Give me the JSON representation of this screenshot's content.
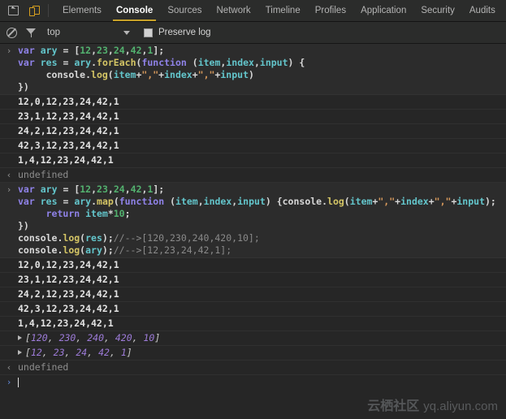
{
  "toolbar": {
    "inspect_icon": "inspect-element-icon",
    "device_icon": "device-toolbar-icon",
    "tabs": [
      {
        "label": "Elements",
        "active": false
      },
      {
        "label": "Console",
        "active": true
      },
      {
        "label": "Sources",
        "active": false
      },
      {
        "label": "Network",
        "active": false
      },
      {
        "label": "Timeline",
        "active": false
      },
      {
        "label": "Profiles",
        "active": false
      },
      {
        "label": "Application",
        "active": false
      },
      {
        "label": "Security",
        "active": false
      },
      {
        "label": "Audits",
        "active": false
      }
    ]
  },
  "filterbar": {
    "clear_icon": "clear-console-icon",
    "filter_icon": "filter-funnel-icon",
    "context": "top",
    "dropdown_icon": "chevron-down-icon",
    "preserve_log_label": "Preserve log",
    "preserve_log_checked": false
  },
  "console": {
    "input_marker": "›",
    "output_marker": "‹",
    "entries": [
      {
        "type": "command",
        "lines": [
          "var ary = [12,23,24,42,1];",
          "var res = ary.forEach(function (item,index,input) {",
          "     console.log(item+\",\"+index+\",\"+input)",
          "})"
        ]
      },
      {
        "type": "log",
        "text": "12,0,12,23,24,42,1"
      },
      {
        "type": "log",
        "text": "23,1,12,23,24,42,1"
      },
      {
        "type": "log",
        "text": "24,2,12,23,24,42,1"
      },
      {
        "type": "log",
        "text": "42,3,12,23,24,42,1"
      },
      {
        "type": "log",
        "text": "1,4,12,23,24,42,1"
      },
      {
        "type": "result",
        "text": "undefined"
      },
      {
        "type": "command",
        "lines": [
          "var ary = [12,23,24,42,1];",
          "var res = ary.map(function (item,index,input) {console.log(item+\",\"+index+\",\"+input);",
          "     return item*10;",
          "})",
          "console.log(res);//-->[120,230,240,420,10];",
          "console.log(ary);//-->[12,23,24,42,1];"
        ]
      },
      {
        "type": "log",
        "text": "12,0,12,23,24,42,1"
      },
      {
        "type": "log",
        "text": "23,1,12,23,24,42,1"
      },
      {
        "type": "log",
        "text": "24,2,12,23,24,42,1"
      },
      {
        "type": "log",
        "text": "42,3,12,23,24,42,1"
      },
      {
        "type": "log",
        "text": "1,4,12,23,24,42,1"
      },
      {
        "type": "array",
        "text": "[120, 230, 240, 420, 10]"
      },
      {
        "type": "array",
        "text": "[12, 23, 24, 42, 1]"
      },
      {
        "type": "result",
        "text": "undefined"
      }
    ],
    "prompt_value": ""
  },
  "watermark": {
    "brand": "云栖社区",
    "url": "yq.aliyun.com"
  },
  "colors": {
    "accent": "#c8a22a",
    "background": "#262626",
    "chrome": "#2b2c2b",
    "keyword": "#8f82e8",
    "identifier": "#63c5cb",
    "number": "#53b26f",
    "function": "#d4c565",
    "string": "#d99a5c",
    "comment": "#8a8a8a",
    "array_number": "#9d7bd8"
  }
}
